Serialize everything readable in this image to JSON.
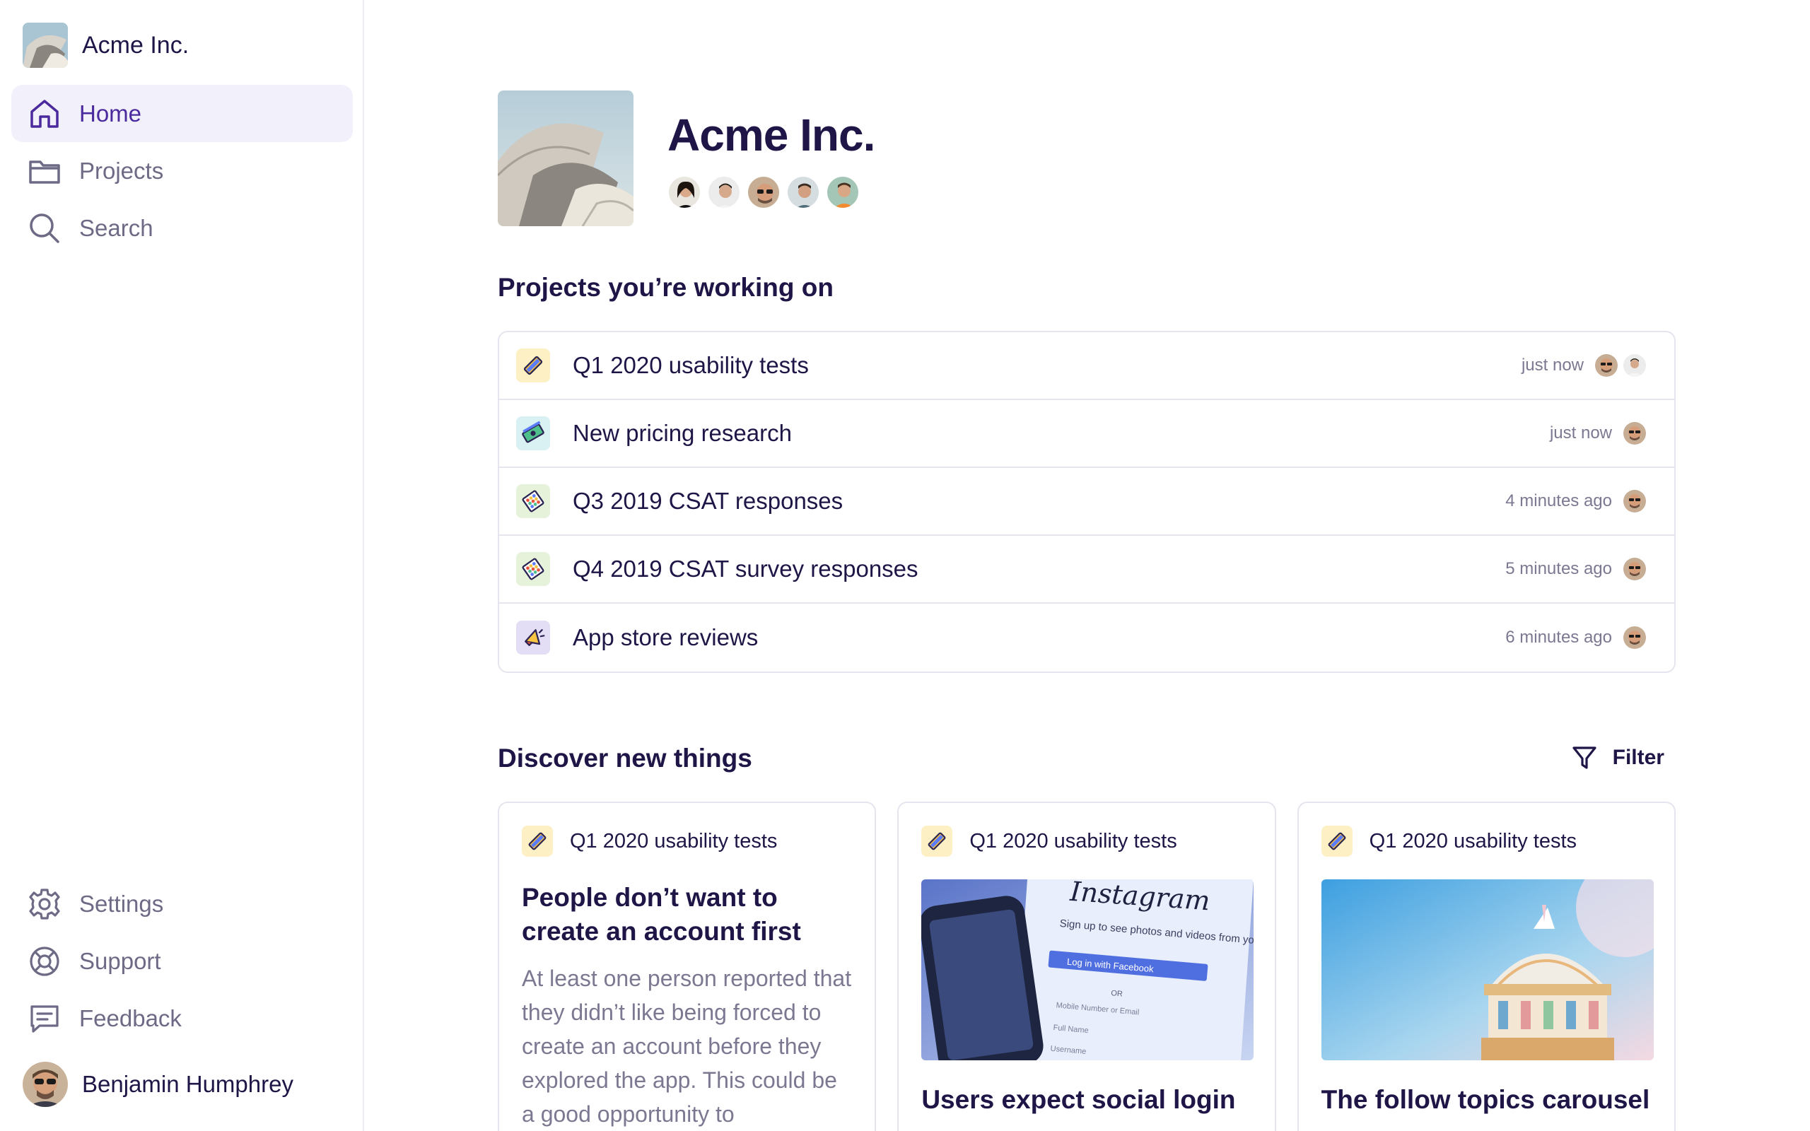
{
  "org": {
    "name": "Acme Inc."
  },
  "nav": {
    "top": [
      {
        "label": "Home",
        "icon": "home-icon",
        "active": true
      },
      {
        "label": "Projects",
        "icon": "folder-icon"
      },
      {
        "label": "Search",
        "icon": "search-icon"
      }
    ],
    "bottom": [
      {
        "label": "Settings",
        "icon": "gear-icon"
      },
      {
        "label": "Support",
        "icon": "lifebuoy-icon"
      },
      {
        "label": "Feedback",
        "icon": "message-icon"
      }
    ]
  },
  "user": {
    "name": "Benjamin Humphrey"
  },
  "header": {
    "title": "Acme Inc."
  },
  "projects": {
    "title": "Projects you’re working on",
    "items": [
      {
        "name": "Q1 2020 usability tests",
        "time": "just now",
        "icon": "pencil-icon"
      },
      {
        "name": "New pricing research",
        "time": "just now",
        "icon": "money-icon"
      },
      {
        "name": "Q3 2019 CSAT responses",
        "time": "4 minutes ago",
        "icon": "abacus-icon"
      },
      {
        "name": "Q4 2019 CSAT survey responses",
        "time": "5 minutes ago",
        "icon": "abacus-icon"
      },
      {
        "name": "App store reviews",
        "time": "6 minutes ago",
        "icon": "megaphone-icon"
      }
    ]
  },
  "discover": {
    "title": "Discover new things",
    "filter_label": "Filter",
    "cards": [
      {
        "project": "Q1 2020 usability tests",
        "title": "People don’t want to create an account first",
        "body": "At least one person reported that they didn’t like being forced to create an account before they explored the app. This could be a good opportunity to"
      },
      {
        "project": "Q1 2020 usability tests",
        "title": "Users expect social login"
      },
      {
        "project": "Q1 2020 usability tests",
        "title": "The follow topics carousel"
      }
    ],
    "instagram": {
      "logo": "Instagram",
      "tagline": "Sign up to see photos and videos from your friends.",
      "button": "Log in with Facebook",
      "or": "OR",
      "field1": "Mobile Number or Email",
      "field2": "Full Name",
      "field3": "Username"
    }
  },
  "colors": {
    "accent": "#4b2a9e",
    "active_bg": "#f2f0fa",
    "text": "#1f1547",
    "muted": "#7b7891",
    "border": "#e6e4ee"
  }
}
